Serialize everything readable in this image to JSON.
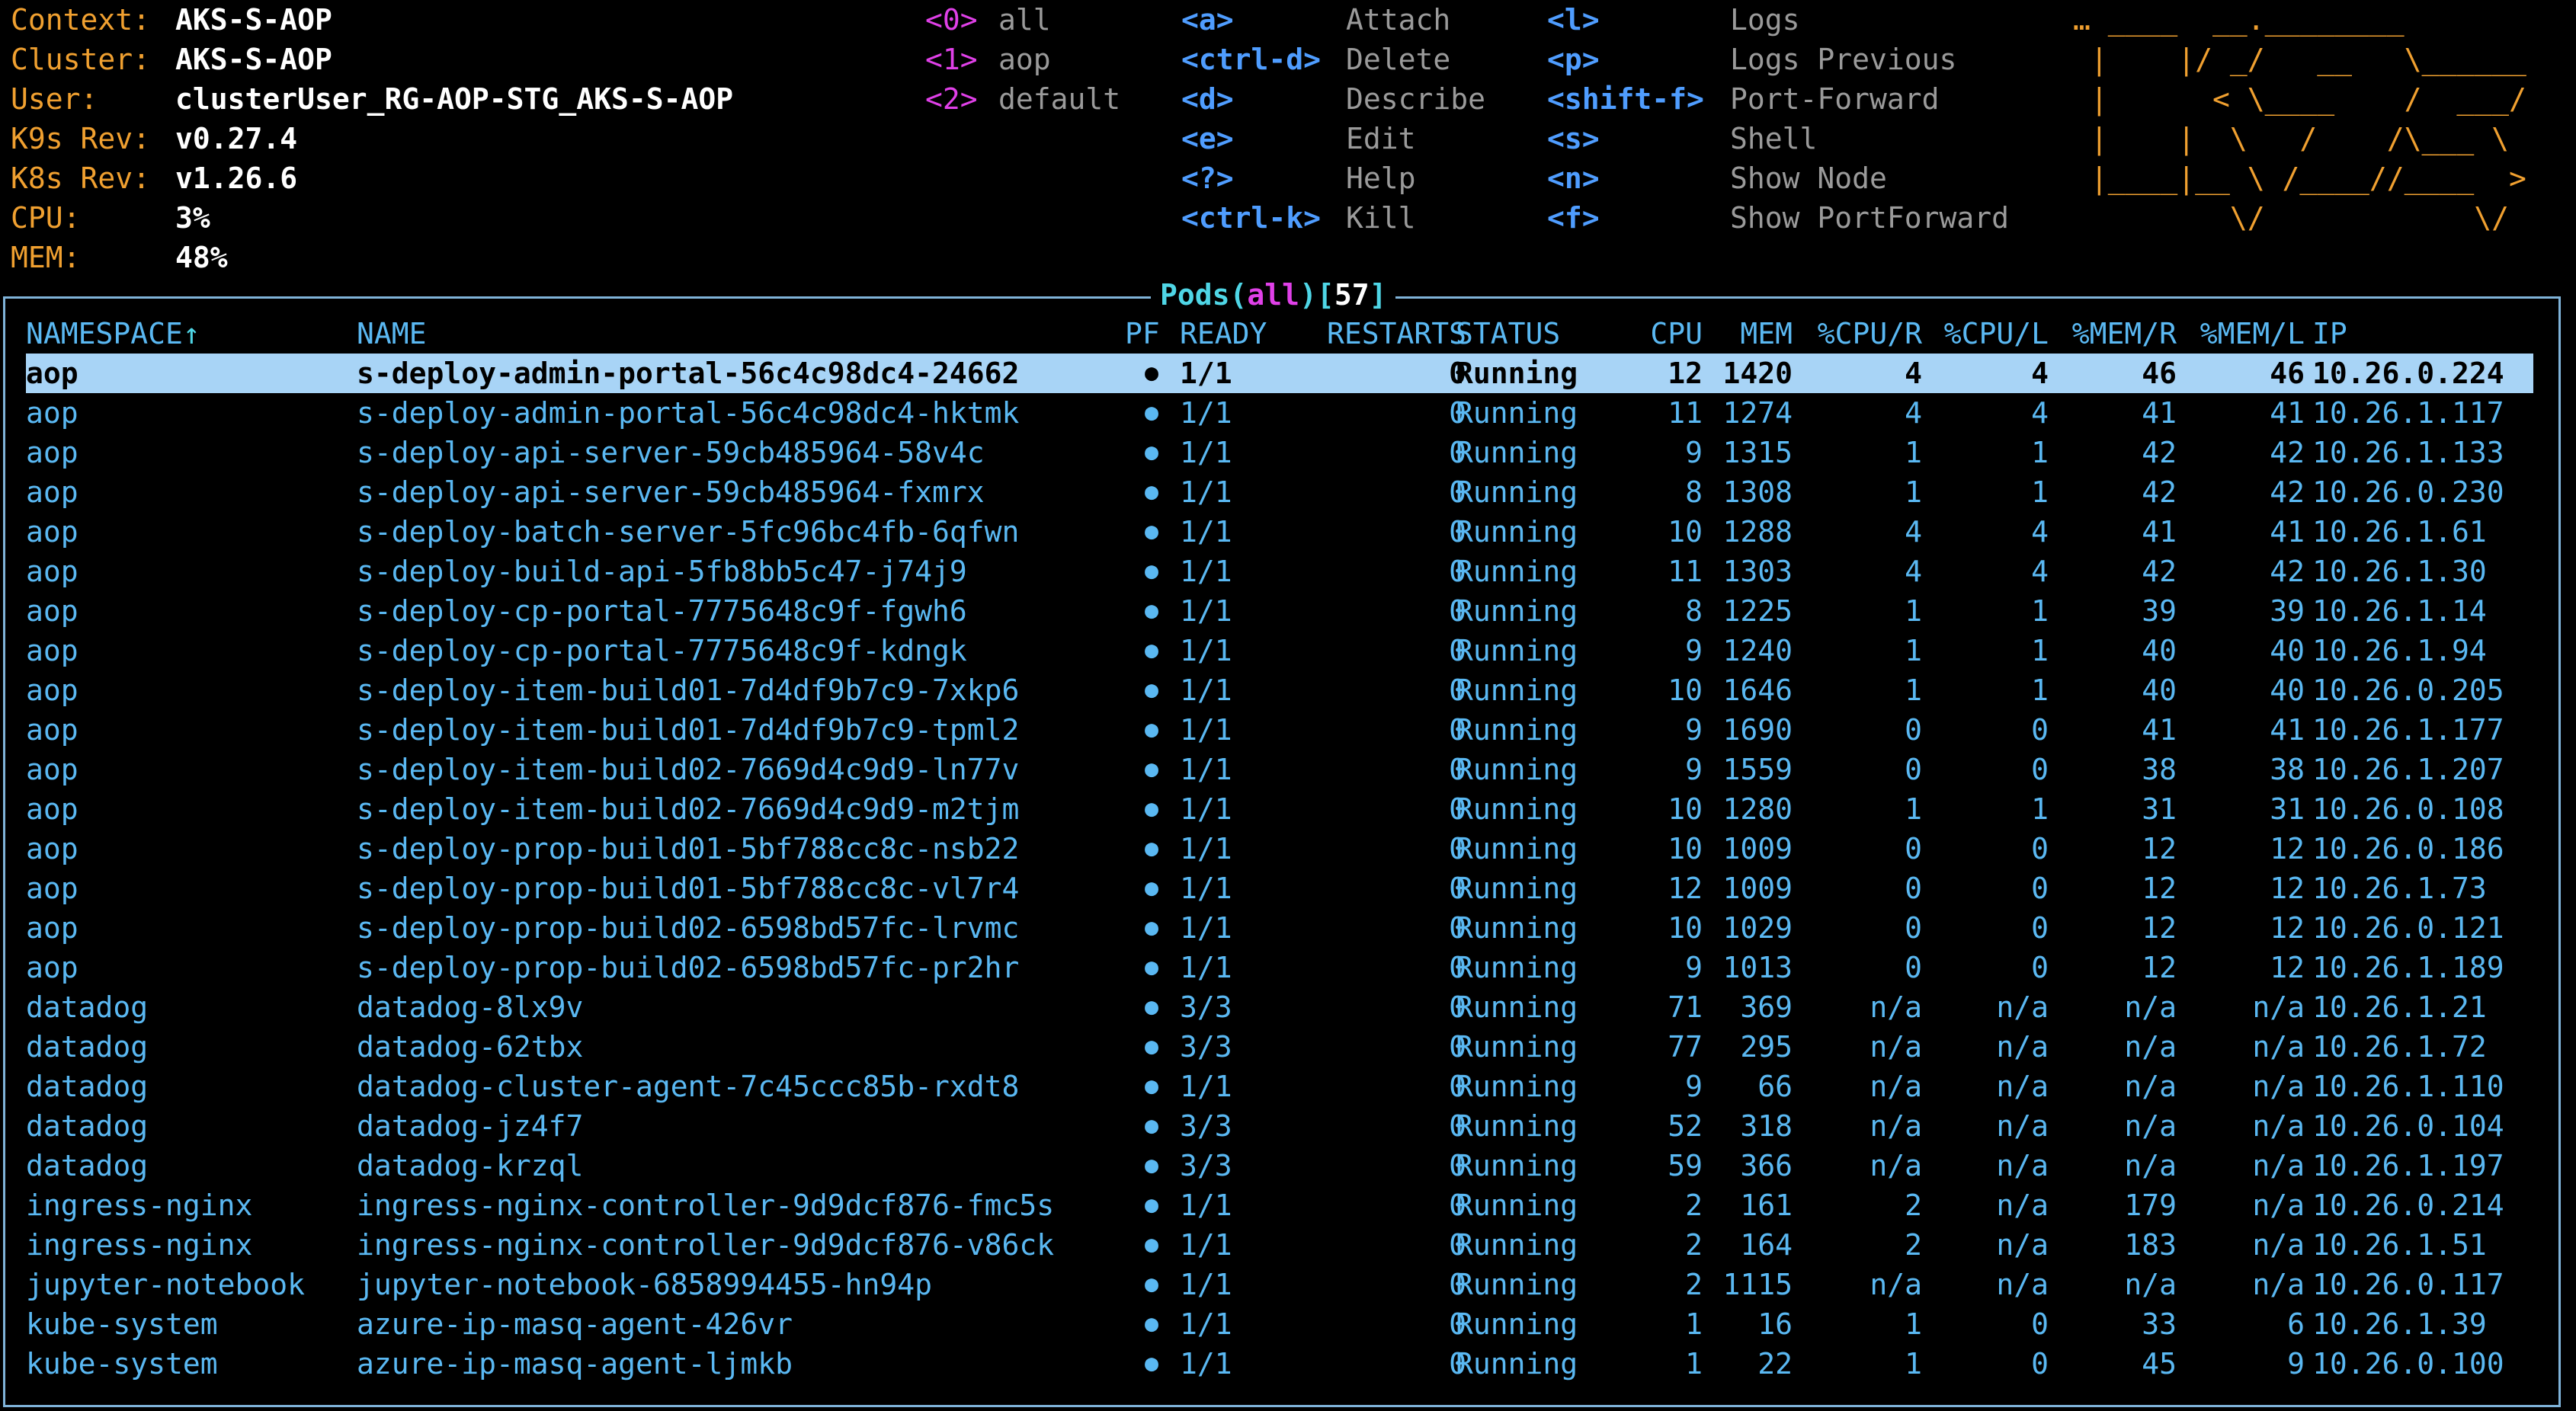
{
  "header": {
    "info": [
      {
        "key": "Context:",
        "value": "AKS-S-AOP"
      },
      {
        "key": "Cluster:",
        "value": "AKS-S-AOP"
      },
      {
        "key": "User:",
        "value": "clusterUser_RG-AOP-STG_AKS-S-AOP"
      },
      {
        "key": "K9s Rev:",
        "value": "v0.27.4"
      },
      {
        "key": "K8s Rev:",
        "value": "v1.26.6"
      },
      {
        "key": "CPU:",
        "value": "3%"
      },
      {
        "key": "MEM:",
        "value": "48%"
      }
    ],
    "namespaces": [
      {
        "key": "<0>",
        "label": "all"
      },
      {
        "key": "<1>",
        "label": "aop"
      },
      {
        "key": "<2>",
        "label": "default"
      }
    ],
    "hints_col1": [
      {
        "key": "<a>",
        "label": "Attach"
      },
      {
        "key": "<ctrl-d>",
        "label": "Delete"
      },
      {
        "key": "<d>",
        "label": "Describe"
      },
      {
        "key": "<e>",
        "label": "Edit"
      },
      {
        "key": "<?>",
        "label": "Help"
      },
      {
        "key": "<ctrl-k>",
        "label": "Kill"
      }
    ],
    "hints_col2": [
      {
        "key": "<l>",
        "label": "Logs"
      },
      {
        "key": "<p>",
        "label": "Logs Previous"
      },
      {
        "key": "<shift-f>",
        "label": "Port-Forward"
      },
      {
        "key": "<s>",
        "label": "Shell"
      },
      {
        "key": "<n>",
        "label": "Show Node"
      },
      {
        "key": "<f>",
        "label": "Show PortForward"
      }
    ],
    "logo_lines": [
      "… ____  __.________       ",
      " |    |/ _/   __   \\______",
      " |      < \\____    /  ___/",
      " |    |  \\   /    /\\___ \\ ",
      " |____|__ \\ /____//____  >",
      "         \\/            \\/ "
    ]
  },
  "table": {
    "title_resource": "Pods",
    "title_scope": "all",
    "title_count": "57",
    "columns": [
      "NAMESPACE",
      "NAME",
      "PF",
      "READY",
      "RESTARTS",
      "STATUS",
      "CPU",
      "MEM",
      "%CPU/R",
      "%CPU/L",
      "%MEM/R",
      "%MEM/L",
      "IP"
    ],
    "sort_indicator": "↑",
    "rows": [
      [
        "aop",
        "s-deploy-admin-portal-56c4c98dc4-24662",
        "●",
        "1/1",
        "0",
        "Running",
        "12",
        "1420",
        "4",
        "4",
        "46",
        "46",
        "10.26.0.224"
      ],
      [
        "aop",
        "s-deploy-admin-portal-56c4c98dc4-hktmk",
        "●",
        "1/1",
        "0",
        "Running",
        "11",
        "1274",
        "4",
        "4",
        "41",
        "41",
        "10.26.1.117"
      ],
      [
        "aop",
        "s-deploy-api-server-59cb485964-58v4c",
        "●",
        "1/1",
        "0",
        "Running",
        "9",
        "1315",
        "1",
        "1",
        "42",
        "42",
        "10.26.1.133"
      ],
      [
        "aop",
        "s-deploy-api-server-59cb485964-fxmrx",
        "●",
        "1/1",
        "0",
        "Running",
        "8",
        "1308",
        "1",
        "1",
        "42",
        "42",
        "10.26.0.230"
      ],
      [
        "aop",
        "s-deploy-batch-server-5fc96bc4fb-6qfwn",
        "●",
        "1/1",
        "0",
        "Running",
        "10",
        "1288",
        "4",
        "4",
        "41",
        "41",
        "10.26.1.61"
      ],
      [
        "aop",
        "s-deploy-build-api-5fb8bb5c47-j74j9",
        "●",
        "1/1",
        "0",
        "Running",
        "11",
        "1303",
        "4",
        "4",
        "42",
        "42",
        "10.26.1.30"
      ],
      [
        "aop",
        "s-deploy-cp-portal-7775648c9f-fgwh6",
        "●",
        "1/1",
        "0",
        "Running",
        "8",
        "1225",
        "1",
        "1",
        "39",
        "39",
        "10.26.1.14"
      ],
      [
        "aop",
        "s-deploy-cp-portal-7775648c9f-kdngk",
        "●",
        "1/1",
        "0",
        "Running",
        "9",
        "1240",
        "1",
        "1",
        "40",
        "40",
        "10.26.1.94"
      ],
      [
        "aop",
        "s-deploy-item-build01-7d4df9b7c9-7xkp6",
        "●",
        "1/1",
        "0",
        "Running",
        "10",
        "1646",
        "1",
        "1",
        "40",
        "40",
        "10.26.0.205"
      ],
      [
        "aop",
        "s-deploy-item-build01-7d4df9b7c9-tpml2",
        "●",
        "1/1",
        "0",
        "Running",
        "9",
        "1690",
        "0",
        "0",
        "41",
        "41",
        "10.26.1.177"
      ],
      [
        "aop",
        "s-deploy-item-build02-7669d4c9d9-ln77v",
        "●",
        "1/1",
        "0",
        "Running",
        "9",
        "1559",
        "0",
        "0",
        "38",
        "38",
        "10.26.1.207"
      ],
      [
        "aop",
        "s-deploy-item-build02-7669d4c9d9-m2tjm",
        "●",
        "1/1",
        "0",
        "Running",
        "10",
        "1280",
        "1",
        "1",
        "31",
        "31",
        "10.26.0.108"
      ],
      [
        "aop",
        "s-deploy-prop-build01-5bf788cc8c-nsb22",
        "●",
        "1/1",
        "0",
        "Running",
        "10",
        "1009",
        "0",
        "0",
        "12",
        "12",
        "10.26.0.186"
      ],
      [
        "aop",
        "s-deploy-prop-build01-5bf788cc8c-vl7r4",
        "●",
        "1/1",
        "0",
        "Running",
        "12",
        "1009",
        "0",
        "0",
        "12",
        "12",
        "10.26.1.73"
      ],
      [
        "aop",
        "s-deploy-prop-build02-6598bd57fc-lrvmc",
        "●",
        "1/1",
        "0",
        "Running",
        "10",
        "1029",
        "0",
        "0",
        "12",
        "12",
        "10.26.0.121"
      ],
      [
        "aop",
        "s-deploy-prop-build02-6598bd57fc-pr2hr",
        "●",
        "1/1",
        "0",
        "Running",
        "9",
        "1013",
        "0",
        "0",
        "12",
        "12",
        "10.26.1.189"
      ],
      [
        "datadog",
        "datadog-8lx9v",
        "●",
        "3/3",
        "0",
        "Running",
        "71",
        "369",
        "n/a",
        "n/a",
        "n/a",
        "n/a",
        "10.26.1.21"
      ],
      [
        "datadog",
        "datadog-62tbx",
        "●",
        "3/3",
        "0",
        "Running",
        "77",
        "295",
        "n/a",
        "n/a",
        "n/a",
        "n/a",
        "10.26.1.72"
      ],
      [
        "datadog",
        "datadog-cluster-agent-7c45ccc85b-rxdt8",
        "●",
        "1/1",
        "0",
        "Running",
        "9",
        "66",
        "n/a",
        "n/a",
        "n/a",
        "n/a",
        "10.26.1.110"
      ],
      [
        "datadog",
        "datadog-jz4f7",
        "●",
        "3/3",
        "0",
        "Running",
        "52",
        "318",
        "n/a",
        "n/a",
        "n/a",
        "n/a",
        "10.26.0.104"
      ],
      [
        "datadog",
        "datadog-krzql",
        "●",
        "3/3",
        "0",
        "Running",
        "59",
        "366",
        "n/a",
        "n/a",
        "n/a",
        "n/a",
        "10.26.1.197"
      ],
      [
        "ingress-nginx",
        "ingress-nginx-controller-9d9dcf876-fmc5s",
        "●",
        "1/1",
        "0",
        "Running",
        "2",
        "161",
        "2",
        "n/a",
        "179",
        "n/a",
        "10.26.0.214"
      ],
      [
        "ingress-nginx",
        "ingress-nginx-controller-9d9dcf876-v86ck",
        "●",
        "1/1",
        "0",
        "Running",
        "2",
        "164",
        "2",
        "n/a",
        "183",
        "n/a",
        "10.26.1.51"
      ],
      [
        "jupyter-notebook",
        "jupyter-notebook-6858994455-hn94p",
        "●",
        "1/1",
        "0",
        "Running",
        "2",
        "1115",
        "n/a",
        "n/a",
        "n/a",
        "n/a",
        "10.26.0.117"
      ],
      [
        "kube-system",
        "azure-ip-masq-agent-426vr",
        "●",
        "1/1",
        "0",
        "Running",
        "1",
        "16",
        "1",
        "0",
        "33",
        "6",
        "10.26.1.39"
      ],
      [
        "kube-system",
        "azure-ip-masq-agent-ljmkb",
        "●",
        "1/1",
        "0",
        "Running",
        "1",
        "22",
        "1",
        "0",
        "45",
        "9",
        "10.26.0.100"
      ]
    ],
    "selected_row": 0
  },
  "colors": {
    "background": "#000000",
    "info_key": "#f0a030",
    "hint_key": "#4f9dff",
    "namespace_key": "#e040e8",
    "row_text": "#5ab8f2",
    "selected_row_bg": "#a8d4f6",
    "frame": "#7fb3d9"
  }
}
